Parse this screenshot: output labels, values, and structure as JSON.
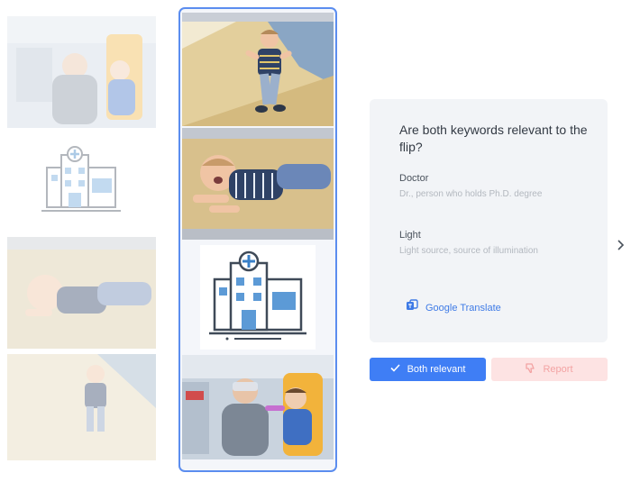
{
  "question": "Are both keywords relevant to the flip?",
  "keywords": [
    {
      "name": "Doctor",
      "description": "Dr., person who holds Ph.D. degree"
    },
    {
      "name": "Light",
      "description": "Light source, source of illumination"
    }
  ],
  "translate_label": "Google Translate",
  "buttons": {
    "relevant_label": "Both relevant",
    "report_label": "Report"
  },
  "icons": {
    "relevant": "check-icon",
    "report": "thumbs-down-icon",
    "translate": "translate-icon",
    "next": "chevron-right-icon"
  },
  "colors": {
    "accent": "#3f7ef5",
    "selected_border": "#5b8def",
    "report_bg": "#fde3e3",
    "report_text": "#f3a3a3",
    "card_bg": "#f2f4f7"
  },
  "flips": {
    "left": [
      "dentist-photo",
      "hospital-icon",
      "crying-child-photo",
      "walking-child-photo"
    ],
    "selected": [
      "walking-child-photo",
      "crying-child-photo",
      "hospital-icon",
      "dentist-photo"
    ]
  }
}
